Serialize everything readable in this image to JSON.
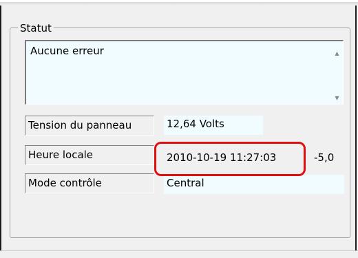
{
  "status": {
    "group_title": "Statut",
    "message": "Aucune erreur",
    "scroll_up_icon": "triangle-up",
    "scroll_down_icon": "triangle-down"
  },
  "fields": {
    "tension": {
      "label": "Tension du panneau",
      "value": "12,64 Volts"
    },
    "heure": {
      "label": "Heure locale",
      "value": "2010-10-19 11:27:03",
      "offset": "-5,0"
    },
    "mode": {
      "label": "Mode contrôle",
      "value": "Central"
    }
  },
  "colors": {
    "highlight": "#e01010",
    "field_background": "#f0fcff",
    "window_background": "#f0f0f0"
  }
}
